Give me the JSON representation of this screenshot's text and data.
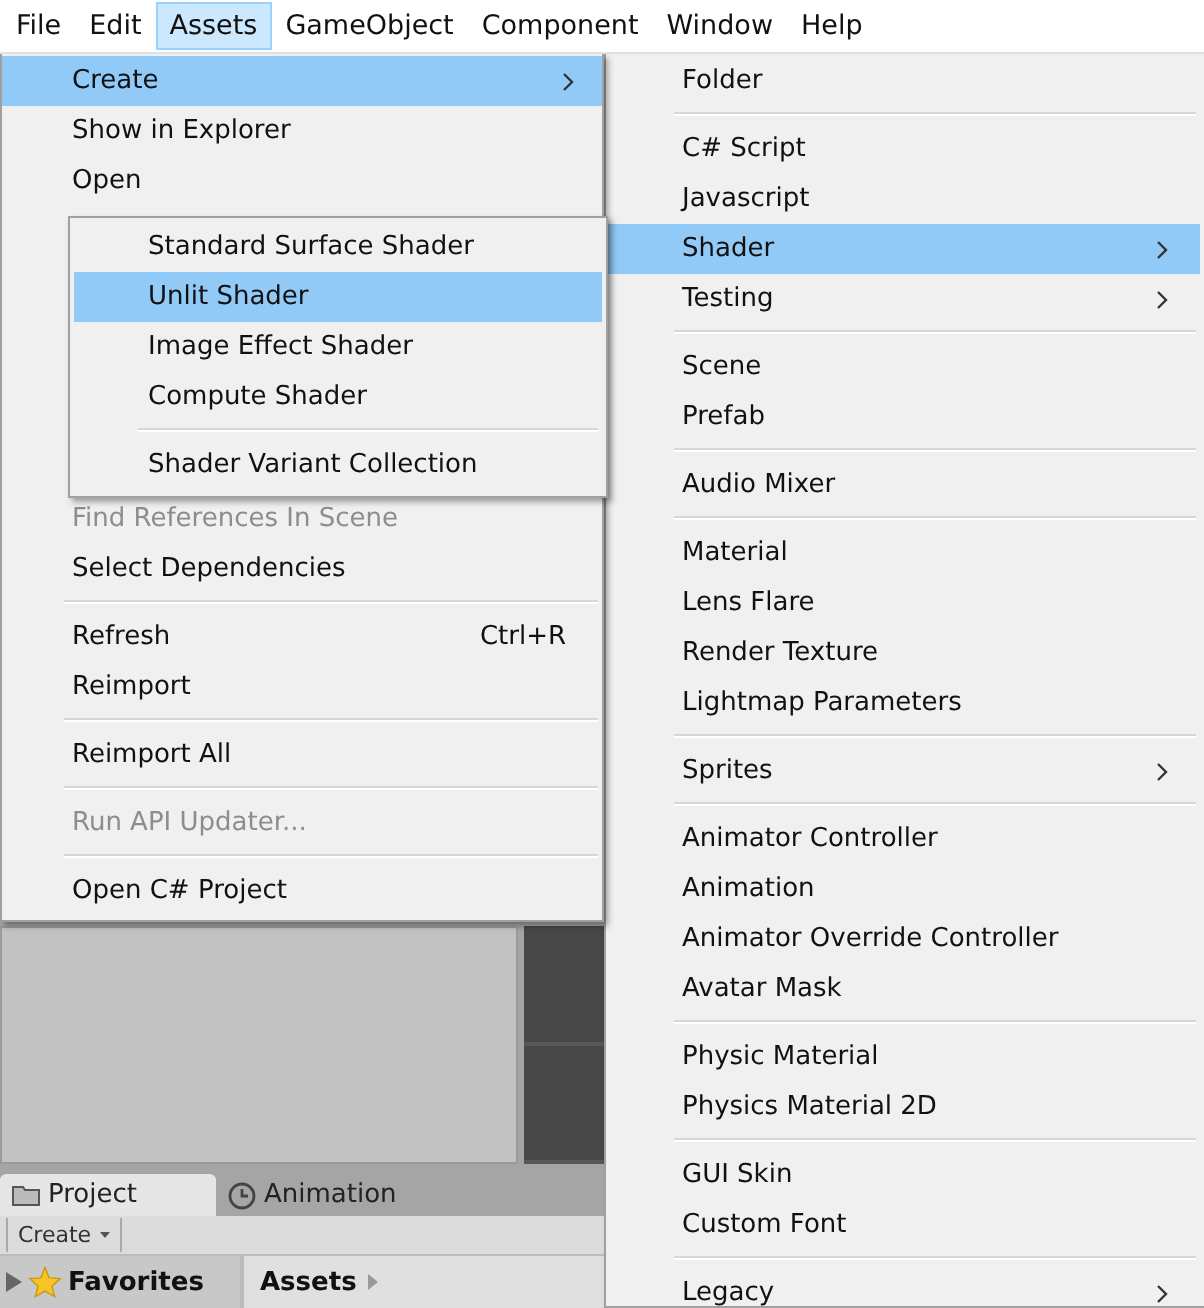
{
  "menubar": [
    {
      "label": "File",
      "selected": false
    },
    {
      "label": "Edit",
      "selected": false
    },
    {
      "label": "Assets",
      "selected": true
    },
    {
      "label": "GameObject",
      "selected": false
    },
    {
      "label": "Component",
      "selected": false
    },
    {
      "label": "Window",
      "selected": false
    },
    {
      "label": "Help",
      "selected": false
    }
  ],
  "assets_menu": {
    "items_top": [
      {
        "kind": "item",
        "label": "Create",
        "selected": true,
        "disabled": false,
        "submenu": true
      },
      {
        "kind": "item",
        "label": "Show in Explorer",
        "selected": false,
        "disabled": false,
        "submenu": false
      },
      {
        "kind": "item",
        "label": "Open",
        "selected": false,
        "disabled": false,
        "submenu": false
      }
    ],
    "items_bottom": [
      {
        "kind": "item",
        "label": "Find References In Scene",
        "selected": false,
        "disabled": true,
        "submenu": false
      },
      {
        "kind": "item",
        "label": "Select Dependencies",
        "selected": false,
        "disabled": false,
        "submenu": false
      },
      {
        "kind": "separator"
      },
      {
        "kind": "item",
        "label": "Refresh",
        "shortcut": "Ctrl+R",
        "selected": false,
        "disabled": false,
        "submenu": false
      },
      {
        "kind": "item",
        "label": "Reimport",
        "selected": false,
        "disabled": false,
        "submenu": false
      },
      {
        "kind": "separator"
      },
      {
        "kind": "item",
        "label": "Reimport All",
        "selected": false,
        "disabled": false,
        "submenu": false
      },
      {
        "kind": "separator"
      },
      {
        "kind": "item",
        "label": "Run API Updater...",
        "selected": false,
        "disabled": true,
        "submenu": false
      },
      {
        "kind": "separator"
      },
      {
        "kind": "item",
        "label": "Open C# Project",
        "selected": false,
        "disabled": false,
        "submenu": false
      }
    ]
  },
  "shader_menu": {
    "items": [
      {
        "kind": "item",
        "label": "Standard Surface Shader",
        "selected": false,
        "submenu": false
      },
      {
        "kind": "item",
        "label": "Unlit Shader",
        "selected": true,
        "submenu": false
      },
      {
        "kind": "item",
        "label": "Image Effect Shader",
        "selected": false,
        "submenu": false
      },
      {
        "kind": "item",
        "label": "Compute Shader",
        "selected": false,
        "submenu": false
      },
      {
        "kind": "separator"
      },
      {
        "kind": "item",
        "label": "Shader Variant Collection",
        "selected": false,
        "submenu": false
      }
    ]
  },
  "create_menu": {
    "items": [
      {
        "kind": "item",
        "label": "Folder",
        "selected": false,
        "submenu": false
      },
      {
        "kind": "separator"
      },
      {
        "kind": "item",
        "label": "C# Script",
        "selected": false,
        "submenu": false
      },
      {
        "kind": "item",
        "label": "Javascript",
        "selected": false,
        "submenu": false
      },
      {
        "kind": "item",
        "label": "Shader",
        "selected": true,
        "submenu": true
      },
      {
        "kind": "item",
        "label": "Testing",
        "selected": false,
        "submenu": true
      },
      {
        "kind": "separator"
      },
      {
        "kind": "item",
        "label": "Scene",
        "selected": false,
        "submenu": false
      },
      {
        "kind": "item",
        "label": "Prefab",
        "selected": false,
        "submenu": false
      },
      {
        "kind": "separator"
      },
      {
        "kind": "item",
        "label": "Audio Mixer",
        "selected": false,
        "submenu": false
      },
      {
        "kind": "separator"
      },
      {
        "kind": "item",
        "label": "Material",
        "selected": false,
        "submenu": false
      },
      {
        "kind": "item",
        "label": "Lens Flare",
        "selected": false,
        "submenu": false
      },
      {
        "kind": "item",
        "label": "Render Texture",
        "selected": false,
        "submenu": false
      },
      {
        "kind": "item",
        "label": "Lightmap Parameters",
        "selected": false,
        "submenu": false
      },
      {
        "kind": "separator"
      },
      {
        "kind": "item",
        "label": "Sprites",
        "selected": false,
        "submenu": true
      },
      {
        "kind": "separator"
      },
      {
        "kind": "item",
        "label": "Animator Controller",
        "selected": false,
        "submenu": false
      },
      {
        "kind": "item",
        "label": "Animation",
        "selected": false,
        "submenu": false
      },
      {
        "kind": "item",
        "label": "Animator Override Controller",
        "selected": false,
        "submenu": false
      },
      {
        "kind": "item",
        "label": "Avatar Mask",
        "selected": false,
        "submenu": false
      },
      {
        "kind": "separator"
      },
      {
        "kind": "item",
        "label": "Physic Material",
        "selected": false,
        "submenu": false
      },
      {
        "kind": "item",
        "label": "Physics Material 2D",
        "selected": false,
        "submenu": false
      },
      {
        "kind": "separator"
      },
      {
        "kind": "item",
        "label": "GUI Skin",
        "selected": false,
        "submenu": false
      },
      {
        "kind": "item",
        "label": "Custom Font",
        "selected": false,
        "submenu": false
      },
      {
        "kind": "separator"
      },
      {
        "kind": "item",
        "label": "Legacy",
        "selected": false,
        "submenu": true
      }
    ]
  },
  "editor": {
    "tabs": [
      {
        "label": "Project",
        "selected": true
      },
      {
        "label": "Animation",
        "selected": false
      }
    ],
    "toolbar": {
      "create_button": "Create"
    },
    "favorites": "Favorites",
    "breadcrumb": "Assets"
  }
}
